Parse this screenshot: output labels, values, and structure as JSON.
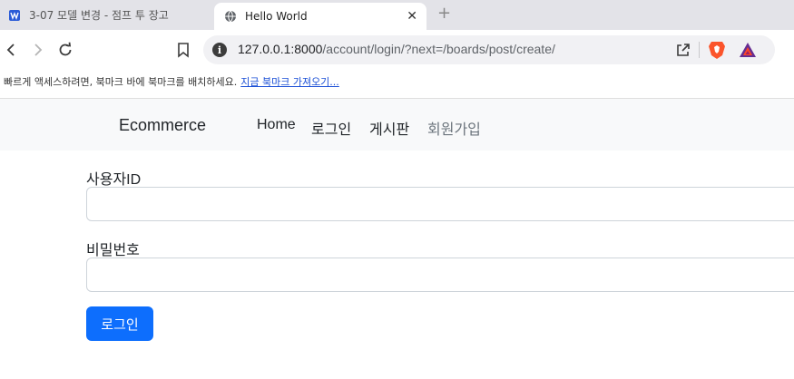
{
  "browser": {
    "tabs": [
      {
        "title": "3-07 모델 변경 - 점프 투 장고",
        "active": false
      },
      {
        "title": "Hello World",
        "active": true
      }
    ],
    "address": {
      "host": "127.0.0.1:8000",
      "path": "/account/login/?next=/boards/post/create/"
    },
    "bookmark_bar": {
      "message": "빠르게 액세스하려면, 북마크 바에 북마크를 배치하세요.",
      "import_link": "지금 북마크 가져오기..."
    }
  },
  "site": {
    "brand": "Ecommerce",
    "nav": [
      {
        "label": "Home",
        "muted": false
      },
      {
        "label": "로그인",
        "muted": false
      },
      {
        "label": "게시판",
        "muted": false
      },
      {
        "label": "회원가입",
        "muted": true
      }
    ]
  },
  "form": {
    "username_label": "사용자ID",
    "username_value": "",
    "password_label": "비밀번호",
    "password_value": "",
    "submit_label": "로그인"
  },
  "colors": {
    "primary": "#0d6efd",
    "navbar_bg": "#f8f9fa",
    "tabstrip_bg": "#e3e3e8"
  }
}
